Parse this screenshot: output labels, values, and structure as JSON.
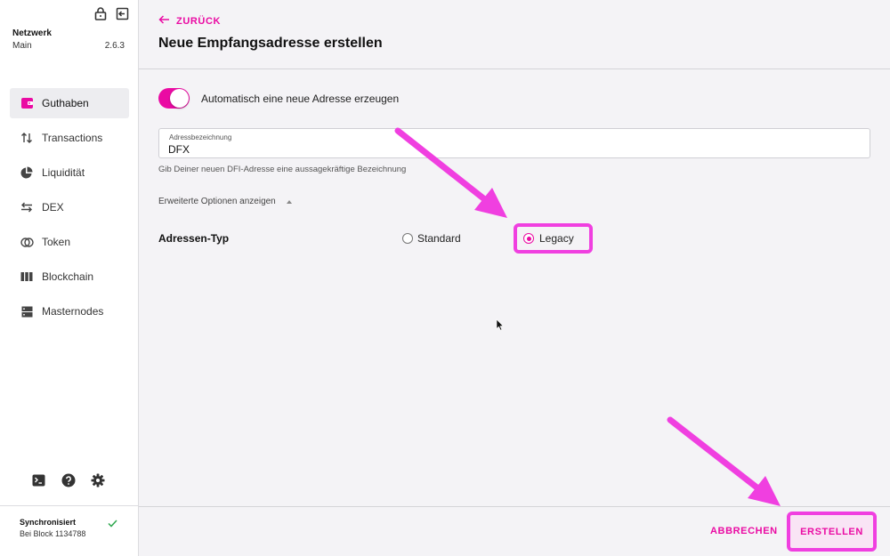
{
  "sidebar": {
    "network_label": "Netzwerk",
    "network_value": "Main",
    "version": "2.6.3",
    "items": [
      {
        "label": "Guthaben",
        "icon": "wallet-icon",
        "active": true
      },
      {
        "label": "Transactions",
        "icon": "transfer-arrows-icon",
        "active": false
      },
      {
        "label": "Liquidität",
        "icon": "pie-chart-icon",
        "active": false
      },
      {
        "label": "DEX",
        "icon": "swap-arrows-icon",
        "active": false
      },
      {
        "label": "Token",
        "icon": "token-icon",
        "active": false
      },
      {
        "label": "Blockchain",
        "icon": "blocks-icon",
        "active": false
      },
      {
        "label": "Masternodes",
        "icon": "server-icon",
        "active": false
      }
    ],
    "sync": {
      "title": "Synchronisiert",
      "block": "Bei Block 1134788"
    }
  },
  "header": {
    "back_label": "ZURÜCK",
    "title": "Neue Empfangsadresse erstellen"
  },
  "form": {
    "auto_toggle": {
      "label": "Automatisch eine neue Adresse erzeugen",
      "on": true
    },
    "address_name": {
      "label": "Adressbezeichnung",
      "value": "DFX",
      "help": "Gib Deiner neuen DFI-Adresse eine aussagekräftige Bezeichnung"
    },
    "advanced_toggle": "Erweiterte Optionen anzeigen",
    "address_type": {
      "label": "Adressen-Typ",
      "options": [
        {
          "label": "Standard",
          "selected": false
        },
        {
          "label": "Legacy",
          "selected": true
        }
      ]
    }
  },
  "footer": {
    "cancel_label": "ABBRECHEN",
    "create_label": "ERSTELLEN"
  },
  "colors": {
    "accent": "#ea0ba3",
    "annotation": "#f03fe0",
    "success": "#2fa84f"
  }
}
